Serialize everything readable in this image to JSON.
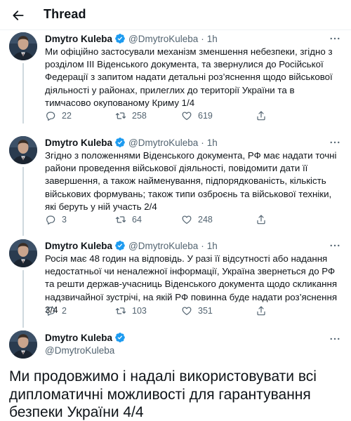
{
  "header": {
    "title": "Thread"
  },
  "tweets": [
    {
      "name": "Dmytro Kuleba",
      "handle": "@DmytroKuleba",
      "dot": "·",
      "time": "1h",
      "text": "Ми офіційно застосували механізм зменшення небезпеки, згідно з розділом III Віденського документа, та звернулися до Російської Федерації з запитом надати детальні роз’яснення щодо військової діяльності у районах, прилеглих до території України та в тимчасово окупованому Криму 1/4",
      "replies": "22",
      "retweets": "258",
      "likes": "619"
    },
    {
      "name": "Dmytro Kuleba",
      "handle": "@DmytroKuleba",
      "dot": "·",
      "time": "1h",
      "text": "Згідно з положеннями Віденського документа, РФ має надати точні райони проведення військової діяльності, повідомити дати її завершення, а також найменування, підпорядкованість, кількість військових формувань; також типи озброєнь та військової техніки, які беруть у ній участь 2/4",
      "replies": "3",
      "retweets": "64",
      "likes": "248"
    },
    {
      "name": "Dmytro Kuleba",
      "handle": "@DmytroKuleba",
      "dot": "·",
      "time": "1h",
      "text": "Росія має 48 годин на відповідь. У разі її відсутності або надання недостатньої чи неналежної інформації, Україна звернеться до РФ та решти держав-учасниць Віденського документа щодо скликання надзвичайної зустрічі, на якій РФ повинна буде надати роз’яснення 3/4",
      "replies": "2",
      "retweets": "103",
      "likes": "351"
    }
  ],
  "main_tweet": {
    "name": "Dmytro Kuleba",
    "handle": "@DmytroKuleba",
    "text": "Ми продовжимо і надалі використовувати всі дипломатичні можливості для гарантування безпеки України 4/4"
  },
  "icons": {
    "back": "arrow-left-icon",
    "verified": "verified-badge-icon",
    "more": "more-dots-icon",
    "reply": "reply-icon",
    "retweet": "retweet-icon",
    "like": "heart-icon",
    "share": "share-icon"
  },
  "colors": {
    "accent": "#1d9bf0",
    "text": "#0f1419",
    "secondary": "#536471",
    "border": "#eff3f4"
  }
}
